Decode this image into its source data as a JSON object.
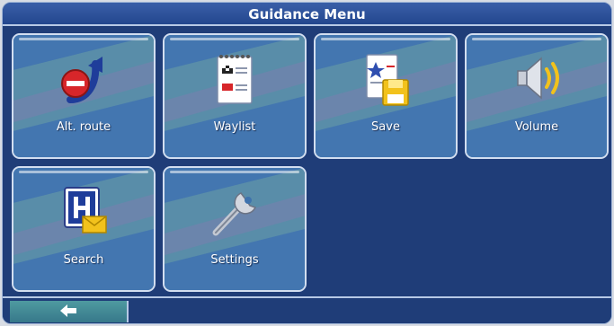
{
  "title": "Guidance Menu",
  "tiles": [
    {
      "label": "Alt. route",
      "icon": "alt-route-icon"
    },
    {
      "label": "Waylist",
      "icon": "waylist-icon"
    },
    {
      "label": "Save",
      "icon": "save-icon"
    },
    {
      "label": "Volume",
      "icon": "volume-icon"
    },
    {
      "label": "Search",
      "icon": "search-hospital-icon"
    },
    {
      "label": "Settings",
      "icon": "wrench-icon"
    }
  ],
  "footer": {
    "back_icon": "back-arrow-icon"
  },
  "colors": {
    "background": "#1f3d78",
    "tile": "#3e72ad",
    "tile_border": "#d2def0",
    "accent_red": "#d7262a",
    "accent_yellow": "#f2c21c"
  }
}
